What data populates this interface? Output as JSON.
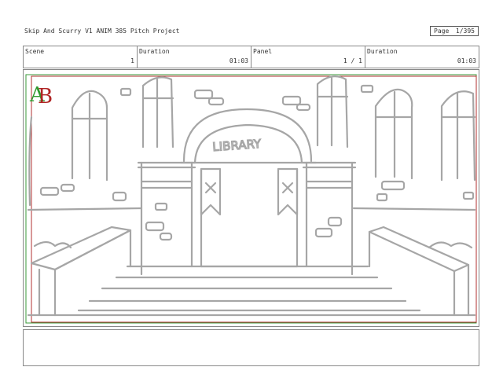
{
  "header": {
    "title": "Skip And Scurry V1  ANIM 385 Pitch Project",
    "page_label": "Page",
    "page_value": "1/395"
  },
  "info": {
    "scene_label": "Scene",
    "scene_value": "1",
    "duration1_label": "Duration",
    "duration1_value": "01:03",
    "panel_label": "Panel",
    "panel_value": "1 / 1",
    "duration2_label": "Duration",
    "duration2_value": "01:03"
  },
  "panel": {
    "logo_text": "AB",
    "sign_text": "LIBRARY",
    "colors": {
      "green_frame": "#3a9a3a",
      "red_frame": "#b03030",
      "sketch": "#a6a6a6"
    }
  },
  "notes": {
    "text": ""
  }
}
